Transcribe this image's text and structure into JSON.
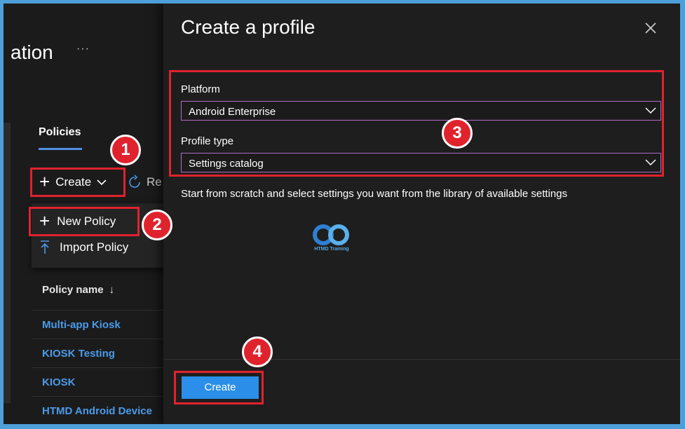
{
  "background": {
    "title": "ation",
    "more": "···",
    "tab": "Policies",
    "create_label": "Create",
    "refresh_label": "Re",
    "menu": [
      {
        "label": "New Policy",
        "icon": "plus-icon"
      },
      {
        "label": "Import Policy",
        "icon": "upload-icon"
      }
    ],
    "column_header": "Policy name",
    "sort_arrow": "↓",
    "rows": [
      "Multi-app Kiosk",
      "KIOSK Testing",
      "KIOSK",
      "HTMD Android Device"
    ]
  },
  "panel": {
    "title": "Create a profile",
    "platform_label": "Platform",
    "platform_value": "Android Enterprise",
    "profile_type_label": "Profile type",
    "profile_type_value": "Settings catalog",
    "description": "Start from scratch and select settings you want from the library of available settings",
    "logo_text": "HTMD Training",
    "create_button": "Create"
  },
  "annotations": [
    "1",
    "2",
    "3",
    "4"
  ],
  "colors": {
    "accent": "#2b8ee8",
    "annotation": "#e0222d",
    "link": "#4a9bea",
    "background": "#1b1b1b"
  }
}
